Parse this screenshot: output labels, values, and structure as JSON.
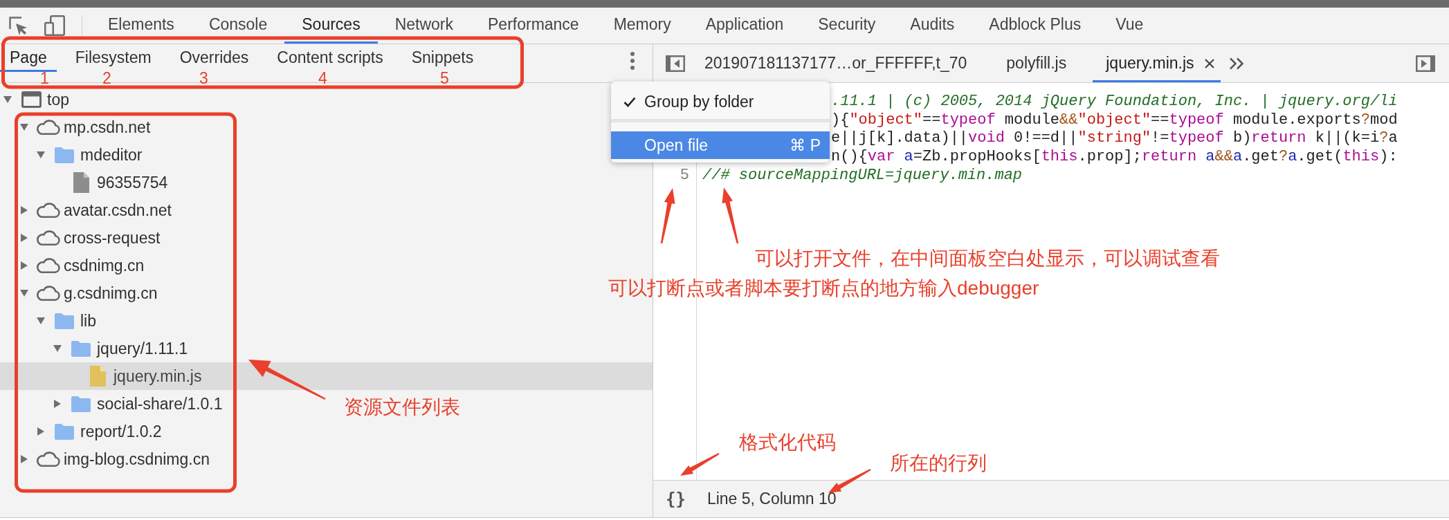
{
  "main_tabs": [
    {
      "label": "Elements",
      "selected": false
    },
    {
      "label": "Console",
      "selected": false
    },
    {
      "label": "Sources",
      "selected": true
    },
    {
      "label": "Network",
      "selected": false
    },
    {
      "label": "Performance",
      "selected": false
    },
    {
      "label": "Memory",
      "selected": false
    },
    {
      "label": "Application",
      "selected": false
    },
    {
      "label": "Security",
      "selected": false
    },
    {
      "label": "Audits",
      "selected": false
    },
    {
      "label": "Adblock Plus",
      "selected": false
    },
    {
      "label": "Vue",
      "selected": false
    }
  ],
  "navigator": {
    "tabs": [
      {
        "label": "Page",
        "selected": true
      },
      {
        "label": "Filesystem",
        "selected": false
      },
      {
        "label": "Overrides",
        "selected": false
      },
      {
        "label": "Content scripts",
        "selected": false
      },
      {
        "label": "Snippets",
        "selected": false
      }
    ],
    "tree": [
      {
        "label": "top",
        "kind": "frame",
        "expanded": true,
        "selected": false,
        "children": [
          {
            "label": "mp.csdn.net",
            "kind": "domain",
            "expanded": true,
            "selected": false,
            "children": [
              {
                "label": "mdeditor",
                "kind": "folder",
                "expanded": true,
                "selected": false,
                "children": [
                  {
                    "label": "96355754",
                    "kind": "document",
                    "selected": false
                  }
                ]
              }
            ]
          },
          {
            "label": "avatar.csdn.net",
            "kind": "domain",
            "expanded": false,
            "selected": false
          },
          {
            "label": "cross-request",
            "kind": "domain",
            "expanded": false,
            "selected": false
          },
          {
            "label": "csdnimg.cn",
            "kind": "domain",
            "expanded": false,
            "selected": false
          },
          {
            "label": "g.csdnimg.cn",
            "kind": "domain",
            "expanded": true,
            "selected": false,
            "children": [
              {
                "label": "lib",
                "kind": "folder",
                "expanded": true,
                "selected": false,
                "children": [
                  {
                    "label": "jquery/1.11.1",
                    "kind": "folder",
                    "expanded": true,
                    "selected": false,
                    "children": [
                      {
                        "label": "jquery.min.js",
                        "kind": "script",
                        "selected": true
                      }
                    ]
                  },
                  {
                    "label": "social-share/1.0.1",
                    "kind": "folder",
                    "expanded": false,
                    "selected": false
                  }
                ]
              },
              {
                "label": "report/1.0.2",
                "kind": "folder",
                "expanded": false,
                "selected": false
              }
            ]
          },
          {
            "label": "img-blog.csdnimg.cn",
            "kind": "domain",
            "expanded": false,
            "selected": false
          }
        ]
      }
    ]
  },
  "editor": {
    "tabs": [
      {
        "label": "201907181137177…or_FFFFFF,t_70",
        "selected": false
      },
      {
        "label": "polyfill.js",
        "selected": false
      },
      {
        "label": "jquery.min.js",
        "selected": true
      }
    ],
    "lines": [
      {
        "kind": "covered",
        "tokens": [
          {
            "kind": "comment",
            "text": ".11.1 | (c) 2005, 2014 jQuery Foundation, Inc. | jquery.org/li"
          }
        ]
      },
      {
        "kind": "covered",
        "tokens": [
          {
            "kind": "plain",
            "text": "){"
          },
          {
            "kind": "string",
            "text": "\"object\""
          },
          {
            "kind": "plain",
            "text": "=="
          },
          {
            "kind": "keyword",
            "text": "typeof"
          },
          {
            "kind": "plain",
            "text": " module"
          },
          {
            "kind": "operator",
            "text": "&&"
          },
          {
            "kind": "string",
            "text": "\"object\""
          },
          {
            "kind": "plain",
            "text": "=="
          },
          {
            "kind": "keyword",
            "text": "typeof"
          },
          {
            "kind": "plain",
            "text": " module.exports"
          },
          {
            "kind": "operator",
            "text": "?"
          },
          {
            "kind": "plain",
            "text": "mod"
          }
        ]
      },
      {
        "kind": "covered",
        "tokens": [
          {
            "kind": "plain",
            "text": "e||j[k].data)||"
          },
          {
            "kind": "keyword",
            "text": "void"
          },
          {
            "kind": "plain",
            "text": " 0!==d||"
          },
          {
            "kind": "string",
            "text": "\"string\""
          },
          {
            "kind": "plain",
            "text": "!="
          },
          {
            "kind": "keyword",
            "text": "typeof"
          },
          {
            "kind": "plain",
            "text": " b)"
          },
          {
            "kind": "keyword",
            "text": "return"
          },
          {
            "kind": "plain",
            "text": " k||(k=i"
          },
          {
            "kind": "operator",
            "text": "?"
          },
          {
            "kind": "plain",
            "text": "a"
          }
        ]
      },
      {
        "kind": "covered",
        "tokens": [
          {
            "kind": "plain",
            "text": "n(){"
          },
          {
            "kind": "keyword",
            "text": "var"
          },
          {
            "kind": "variable",
            "text": " a"
          },
          {
            "kind": "plain",
            "text": "=Zb.propHooks["
          },
          {
            "kind": "keyword",
            "text": "this"
          },
          {
            "kind": "plain",
            "text": ".prop];"
          },
          {
            "kind": "keyword",
            "text": "return"
          },
          {
            "kind": "variable",
            "text": " a"
          },
          {
            "kind": "operator",
            "text": "&&"
          },
          {
            "kind": "variable",
            "text": "a"
          },
          {
            "kind": "plain",
            "text": ".get"
          },
          {
            "kind": "operator",
            "text": "?"
          },
          {
            "kind": "variable",
            "text": "a"
          },
          {
            "kind": "plain",
            "text": ".get("
          },
          {
            "kind": "keyword",
            "text": "this"
          },
          {
            "kind": "plain",
            "text": "):"
          }
        ]
      },
      {
        "kind": "full",
        "number": "5",
        "tokens": [
          {
            "kind": "comment",
            "text": "//# sourceMappingURL=jquery.min.map"
          }
        ]
      }
    ]
  },
  "context_menu": {
    "items": [
      {
        "label": "Group by folder",
        "checked": true,
        "selected": false
      },
      {
        "label": "Open file",
        "checked": false,
        "selected": true,
        "shortcut": "⌘ P"
      }
    ]
  },
  "status_bar": {
    "format_button": "{}",
    "position": "Line 5, Column 10"
  },
  "annotations": {
    "tab_numbers": [
      "1",
      "2",
      "3",
      "4",
      "5"
    ],
    "notes": [
      "可以打开文件，在中间面板空白处显示，可以调试查看",
      "可以打断点或者脚本要打断点的地方输入debugger",
      "资源文件列表",
      "格式化代码",
      "所在的行列"
    ]
  }
}
